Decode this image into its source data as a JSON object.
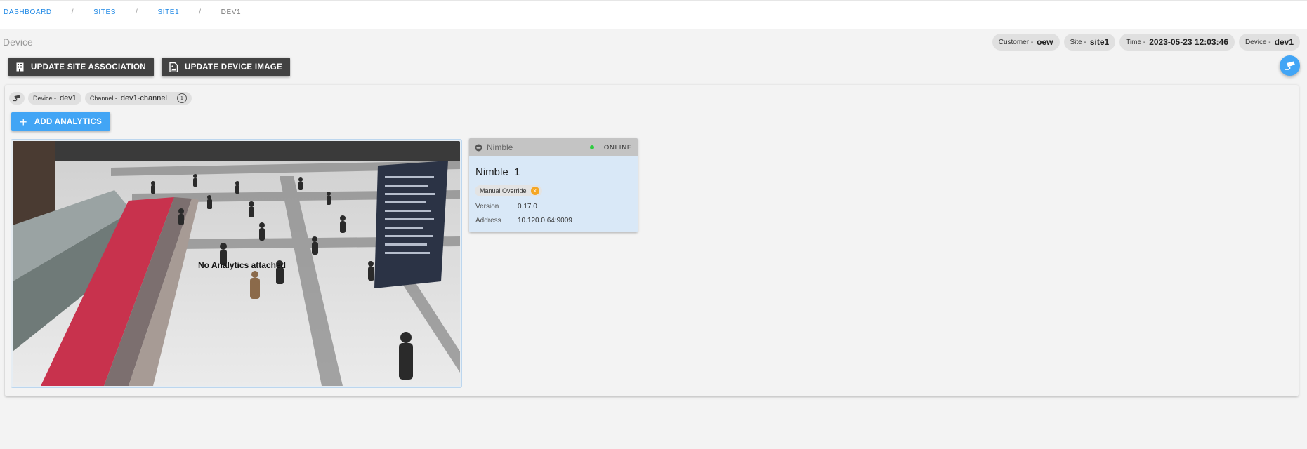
{
  "breadcrumb": [
    {
      "label": "DASHBOARD"
    },
    {
      "label": "SITES"
    },
    {
      "label": "SITE1"
    },
    {
      "label": "DEV1"
    }
  ],
  "page": {
    "title": "Device"
  },
  "context_chips": {
    "customer": {
      "key": "Customer -",
      "value": "oew"
    },
    "site": {
      "key": "Site -",
      "value": "site1"
    },
    "time": {
      "key": "Time -",
      "value": "2023-05-23 12:03:46"
    },
    "device": {
      "key": "Device -",
      "value": "dev1"
    }
  },
  "toolbar": {
    "update_site_label": "UPDATE SITE ASSOCIATION",
    "update_image_label": "UPDATE DEVICE IMAGE"
  },
  "channel_bar": {
    "device": {
      "key": "Device -",
      "value": "dev1"
    },
    "channel": {
      "key": "Channel -",
      "value": "dev1-channel"
    },
    "info_glyph": "i"
  },
  "add_analytics_label": "ADD ANALYTICS",
  "video": {
    "overlay_text": "No Analytics attached"
  },
  "analytics_card": {
    "brand": "Nimble",
    "status": "ONLINE",
    "name": "Nimble_1",
    "override_label": "Manual Override",
    "version_label": "Version",
    "version": "0.17.0",
    "address_label": "Address",
    "address": "10.120.0.64:9009"
  },
  "icons": {
    "site": "building-icon",
    "image": "image-file-icon",
    "camera": "cctv-camera-icon",
    "info": "info-circle-icon",
    "add": "plus-icon",
    "brand": "nimble-logo-icon",
    "remove": "close-icon"
  },
  "colors": {
    "accent": "#42a5f5",
    "link": "#1e88e5",
    "dark_button": "#424242",
    "online": "#2ecc40",
    "override": "#f5a623",
    "card_bg": "#d9e8f7"
  }
}
